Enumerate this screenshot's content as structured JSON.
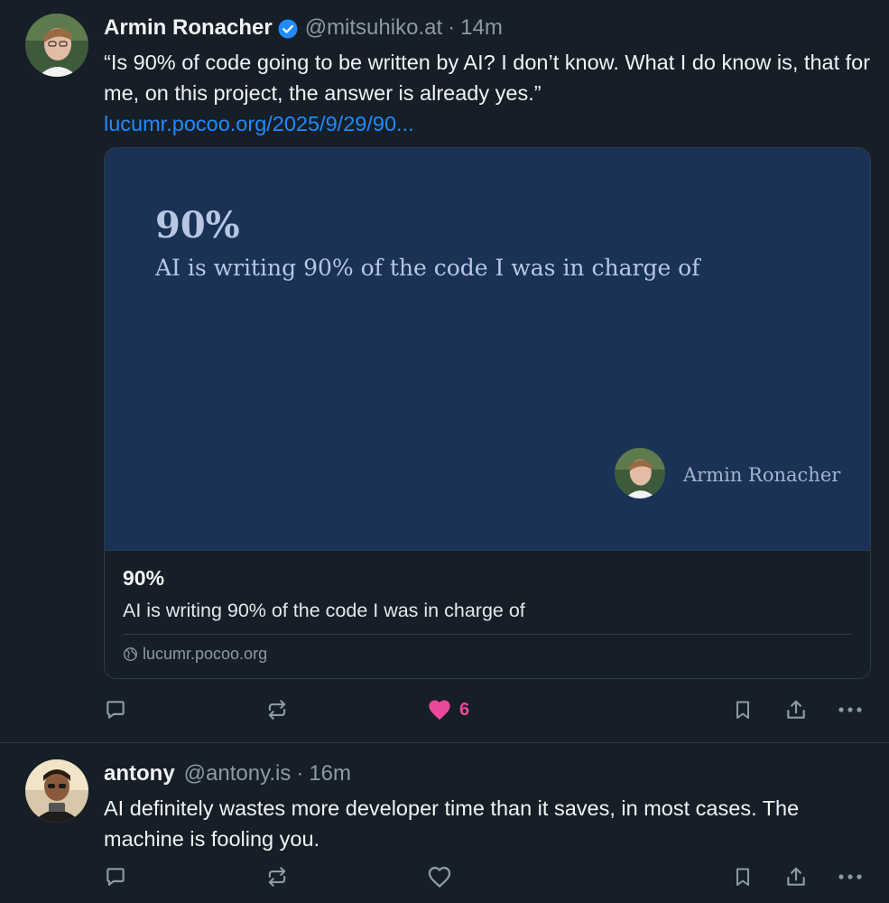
{
  "colors": {
    "background": "#161e27",
    "text": "#f1f3f5",
    "muted": "#8d99a6",
    "link": "#208bfe",
    "like_active": "#ec4899",
    "card_image_bg": "#1a3256"
  },
  "posts": [
    {
      "author": "Armin Ronacher",
      "verified": true,
      "handle": "@mitsuhiko.at",
      "separator": "·",
      "time": "14m",
      "text": "“Is 90% of code going to be written by AI?  I don’t know.  What I do know is, that for me, on this project, the answer is already yes.”",
      "link": "lucumr.pocoo.org/2025/9/29/90...",
      "embed": {
        "image_title": "90%",
        "image_subtitle": "AI is writing 90% of the code I was in charge of",
        "image_author": "Armin Ronacher",
        "title": "90%",
        "description": "AI is writing 90% of the code I was in charge of",
        "domain": "lucumr.pocoo.org"
      },
      "actions": {
        "like_count": "6",
        "liked": true
      }
    },
    {
      "author": "antony",
      "verified": false,
      "handle": "@antony.is",
      "separator": "·",
      "time": "16m",
      "text": "AI definitely wastes more developer time than it saves, in most cases. The machine is fooling you.",
      "actions": {
        "like_count": "",
        "liked": false
      }
    }
  ],
  "icons": {
    "reply": "speech-bubble",
    "repost": "repost-arrows",
    "like": "heart",
    "bookmark": "bookmark",
    "share": "share-upload",
    "more": "horizontal-ellipsis",
    "verified": "check-badge",
    "globe": "globe"
  }
}
